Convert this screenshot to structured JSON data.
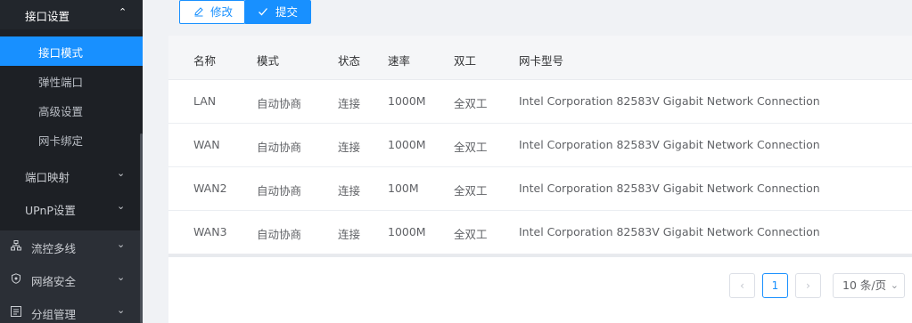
{
  "sidebar": {
    "submenu_title": "接口设置",
    "sub_items": [
      {
        "label": "接口模式",
        "active": true
      },
      {
        "label": "弹性端口",
        "active": false
      },
      {
        "label": "高级设置",
        "active": false
      },
      {
        "label": "网卡绑定",
        "active": false
      }
    ],
    "menu_items": [
      {
        "label": "端口映射",
        "icon": "chevron-down-icon"
      },
      {
        "label": "UPnP设置",
        "icon": "chevron-down-icon"
      }
    ],
    "top_items": [
      {
        "label": "流控多线",
        "icon": "network-icon"
      },
      {
        "label": "网络安全",
        "icon": "shield-icon"
      },
      {
        "label": "分组管理",
        "icon": "group-icon"
      }
    ]
  },
  "toolbar": {
    "edit_label": "修改",
    "submit_label": "提交"
  },
  "table": {
    "headers": [
      "名称",
      "模式",
      "状态",
      "速率",
      "双工",
      "网卡型号"
    ],
    "rows": [
      [
        "LAN",
        "自动协商",
        "连接",
        "1000M",
        "全双工",
        "Intel Corporation 82583V Gigabit Network Connection"
      ],
      [
        "WAN",
        "自动协商",
        "连接",
        "1000M",
        "全双工",
        "Intel Corporation 82583V Gigabit Network Connection"
      ],
      [
        "WAN2",
        "自动协商",
        "连接",
        "100M",
        "全双工",
        "Intel Corporation 82583V Gigabit Network Connection"
      ],
      [
        "WAN3",
        "自动协商",
        "连接",
        "1000M",
        "全双工",
        "Intel Corporation 82583V Gigabit Network Connection"
      ]
    ]
  },
  "pagination": {
    "current_page": "1",
    "page_size": "10 条/页"
  },
  "colors": {
    "accent": "#1890ff",
    "sidebar_bg": "#1d2025"
  }
}
